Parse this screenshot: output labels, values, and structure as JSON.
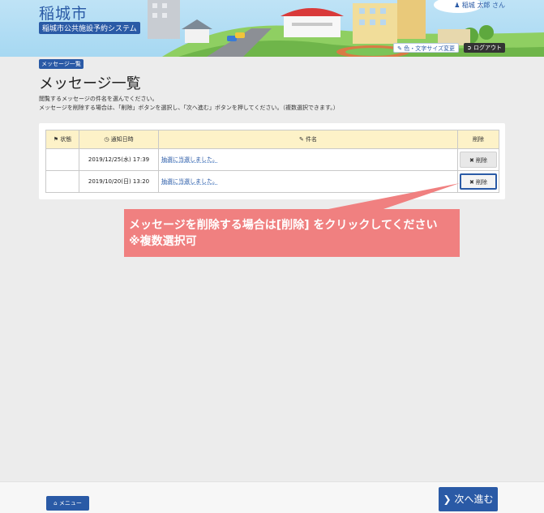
{
  "header": {
    "city": "稲城市",
    "system": "稲城市公共施設予約システム",
    "user": "稲城 太郎 さん",
    "color_size_label": "色・文字サイズ変更",
    "logout_label": "ログアウト"
  },
  "breadcrumb": "メッセージ一覧",
  "page_title": "メッセージ一覧",
  "description": [
    "閲覧するメッセージの件名を選んでください。",
    "メッセージを削除する場合は、「削除」ボタンを選択し、「次へ進む」ボタンを押してください。（複数選択できます。）"
  ],
  "table": {
    "headers": {
      "status": "状態",
      "date": "通知日時",
      "subject": "件名",
      "delete": "削除"
    },
    "rows": [
      {
        "status": "",
        "date": "2019/12/25(水) 17:39",
        "subject": "抽選に当選しました。",
        "delete": "削除"
      },
      {
        "status": "",
        "date": "2019/10/20(日) 13:20",
        "subject": "抽選に当選しました。",
        "delete": "削除"
      }
    ]
  },
  "callout": {
    "line1": "メッセージを削除する場合は[削除] をクリックしてください",
    "line2": "※複数選択可"
  },
  "footer": {
    "menu_label": "メニュー",
    "next_label": "次へ進む"
  },
  "colors": {
    "primary": "#2a5aa6",
    "callout": "#f08080",
    "table_header": "#fdf2c8"
  }
}
